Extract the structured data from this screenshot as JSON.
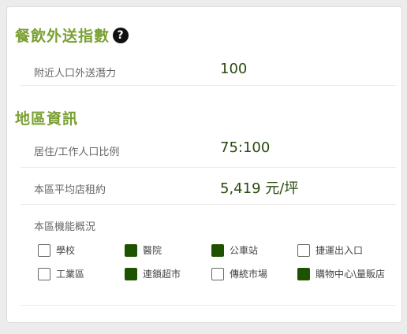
{
  "delivery_section": {
    "title": "餐飲外送指數",
    "help_symbol": "?",
    "rows": [
      {
        "label": "附近人口外送潛力",
        "value": "100"
      }
    ]
  },
  "area_section": {
    "title": "地區資訊",
    "rows": [
      {
        "label": "居住/工作人口比例",
        "value": "75:100"
      },
      {
        "label": "本區平均店租約",
        "value": "5,419 元/坪"
      }
    ],
    "functions_label": "本區機能概況",
    "functions": [
      {
        "label": "學校",
        "checked": false
      },
      {
        "label": "醫院",
        "checked": true
      },
      {
        "label": "公車站",
        "checked": true
      },
      {
        "label": "捷運出入口",
        "checked": false
      },
      {
        "label": "工業區",
        "checked": false
      },
      {
        "label": "連鎖超市",
        "checked": true
      },
      {
        "label": "傳統市場",
        "checked": false
      },
      {
        "label": "購物中心\\量販店",
        "checked": true
      }
    ]
  },
  "colors": {
    "accent_title": "#7aa032",
    "value_text": "#2a4a10",
    "checked_fill": "#1f5200"
  }
}
